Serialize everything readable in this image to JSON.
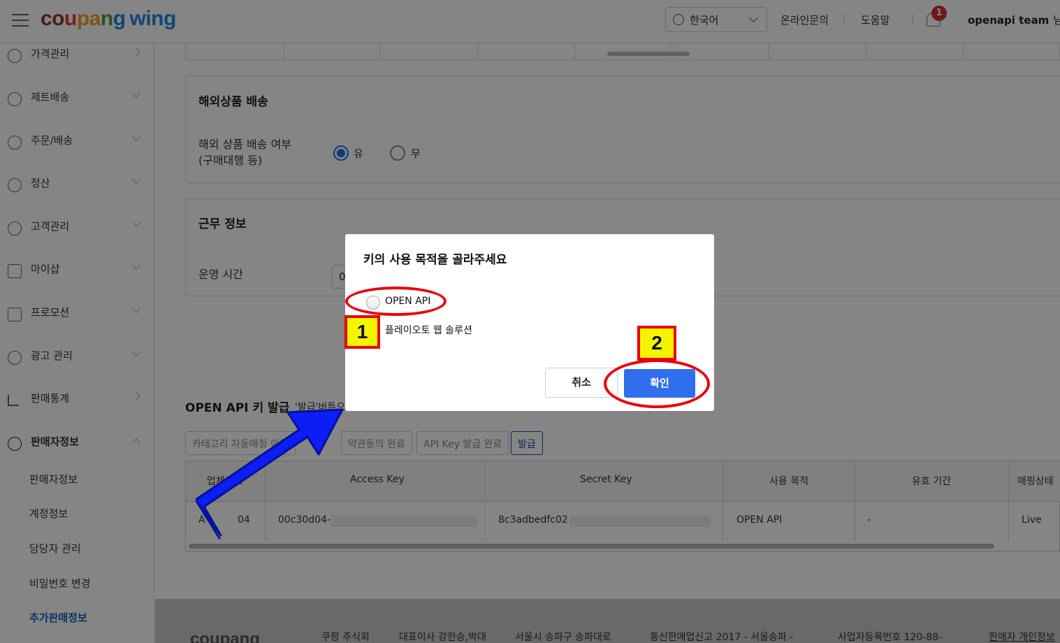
{
  "header": {
    "logo": {
      "c1": "co",
      "c2": "u",
      "c3": "pa",
      "c4": "n",
      "c5": "g",
      "wing": "wing"
    },
    "language": "한국어",
    "links": [
      "온라인문의",
      "도움말"
    ],
    "notification_count": "1",
    "user_name": "openapi team",
    "user_suffix": "님"
  },
  "sidebar": {
    "items": [
      {
        "label": "가격관리"
      },
      {
        "label": "제트배송"
      },
      {
        "label": "주문/배송"
      },
      {
        "label": "정산"
      },
      {
        "label": "고객관리"
      },
      {
        "label": "마이샵"
      },
      {
        "label": "프로모션"
      },
      {
        "label": "광고 관리"
      },
      {
        "label": "판매통계"
      },
      {
        "label": "판매자정보"
      }
    ],
    "subitems": [
      "판매자정보",
      "계정정보",
      "담당자 관리",
      "비밀번호 변경",
      "추가판매정보"
    ]
  },
  "overseas": {
    "title": "해외상품 배송",
    "label_line1": "해외 상품 배송 여부",
    "label_line2": "(구매대행 등)",
    "options": [
      "유",
      "무"
    ],
    "selected": "유"
  },
  "work": {
    "title": "근무 정보",
    "label": "운영 시간",
    "time_value": "0"
  },
  "openapi": {
    "title": "OPEN API 키 발급",
    "note": "'발급'버튼으",
    "tabs": [
      "카테고리 자동매칭 이용",
      "약관동의 완료",
      "API Key 발급 완료",
      "발급"
    ],
    "columns": [
      "업체코드",
      "Access Key",
      "Secret Key",
      "사용 목적",
      "유효 기간",
      "매핑상태"
    ],
    "row": {
      "vendor_code_start": "A",
      "vendor_code_end": "04",
      "access_key": "00c30d04-",
      "secret_key": "8c3adbedfc02",
      "purpose": "OPEN API",
      "validity": "-",
      "status": "Live"
    }
  },
  "footer": {
    "logo": "coupang",
    "items": [
      "쿠팡 주식회",
      "대표이사 강한승,박대",
      "서울시 송파구 송파대로",
      "통신판매업신고 2017 - 서울송파 -",
      "사업자등록번호 120-88-",
      "판매자 개인정보"
    ]
  },
  "modal": {
    "title": "키의 사용 목적을 골라주세요",
    "options": [
      "OPEN API",
      "플레이오토 웹 솔루션"
    ],
    "cancel": "취소",
    "confirm": "확인"
  },
  "annotations": {
    "step1": "1",
    "step2": "2",
    "highlight_color": "#e8000b",
    "box_color": "#f4f400",
    "arrow_color": "#0a1ef5"
  }
}
